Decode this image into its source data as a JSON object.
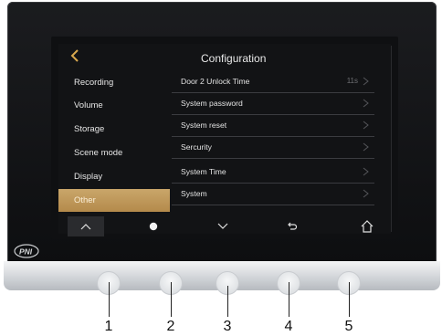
{
  "header": {
    "title": "Configuration"
  },
  "menu": {
    "items": [
      {
        "label": "Recording"
      },
      {
        "label": "Volume"
      },
      {
        "label": "Storage"
      },
      {
        "label": "Scene mode"
      },
      {
        "label": "Display"
      },
      {
        "label": "Other",
        "active": true
      }
    ]
  },
  "list": {
    "rows": [
      {
        "label": "Door 2 Unlock Time",
        "value": "11s"
      },
      {
        "label": "System  password"
      },
      {
        "label": "System reset"
      },
      {
        "label": "Sercurity"
      },
      {
        "label": "System Time"
      },
      {
        "label": "System"
      }
    ]
  },
  "navbar": {
    "icons": [
      "chevron-up-icon",
      "home-dot-icon",
      "chevron-down-icon",
      "return-icon",
      "home-icon"
    ]
  },
  "brand": {
    "logo_text": "PNI"
  },
  "buttons": {
    "labels": [
      "1",
      "2",
      "3",
      "4",
      "5"
    ]
  },
  "colors": {
    "accent": "#b8904f",
    "screen_bg": "#121315"
  }
}
